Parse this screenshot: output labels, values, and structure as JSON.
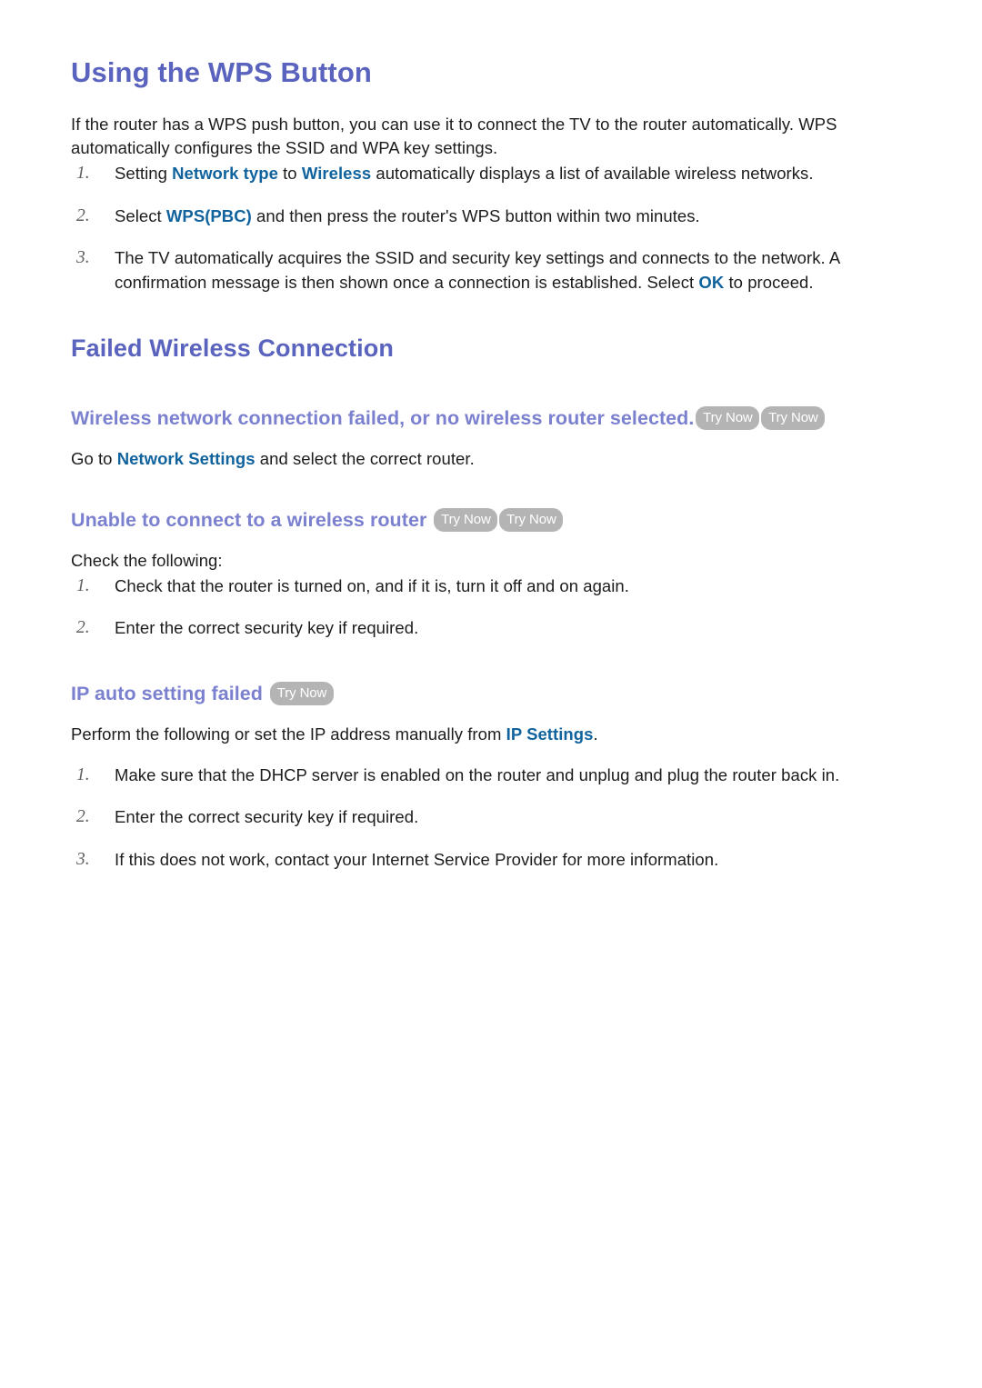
{
  "document": {
    "sections": [
      {
        "id": "using-wps-button",
        "heading": "Using the WPS Button",
        "intro": "If the router has a WPS push button, you can use it to connect the TV to the router automatically. WPS automatically configures the SSID and WPA key settings.",
        "steps": [
          {
            "marker": "1.",
            "pre": "Setting ",
            "kw1": "Network type",
            "mid": " to ",
            "kw2": "Wireless",
            "post": " automatically displays a list of available wireless networks."
          },
          {
            "marker": "2.",
            "pre": "Select ",
            "kw1": "WPS(PBC)",
            "post": " and then press the router's WPS button within two minutes."
          },
          {
            "marker": "3.",
            "pre": "The TV automatically acquires the SSID and security key settings and connects to the network. A confirmation message is then shown once a connection is established. Select ",
            "kw1": "OK",
            "post": " to proceed."
          }
        ]
      }
    ],
    "failed_wireless": {
      "heading": "Failed Wireless Connection",
      "subsections": [
        {
          "id": "wireless-connection-failed",
          "heading": "Wireless network connection failed, or no wireless router selected.",
          "badges": [
            "Try Now",
            "Try Now"
          ],
          "body_pre": "Go to ",
          "body_kw": "Network Settings",
          "body_post": " and select the correct router."
        },
        {
          "id": "unable-to-connect",
          "heading": "Unable to connect to a wireless router",
          "badges": [
            "Try Now",
            "Try Now"
          ],
          "lead": "Check the following:",
          "steps": [
            {
              "marker": "1.",
              "text": "Check that the router is turned on, and if it is, turn it off and on again."
            },
            {
              "marker": "2.",
              "text": "Enter the correct security key if required."
            }
          ]
        },
        {
          "id": "ip-auto-setting-failed",
          "heading": "IP auto setting failed",
          "badges": [
            "Try Now"
          ],
          "lead_pre": "Perform the following or set the IP address manually from ",
          "lead_kw": "IP Settings",
          "lead_post": ".",
          "steps": [
            {
              "marker": "1.",
              "text": "Make sure that the DHCP server is enabled on the router and unplug and plug the router back in."
            },
            {
              "marker": "2.",
              "text": "Enter the correct security key if required."
            },
            {
              "marker": "3.",
              "text": "If this does not work, contact your Internet Service Provider for more information."
            }
          ]
        }
      ]
    },
    "colors": {
      "heading_primary": "#5a63bd",
      "heading_secondary": "#7b80cf",
      "keyword_blue": "#11639e",
      "badge_bg": "#b4b4b4",
      "badge_text": "#ffffff",
      "body_text": "#1c1c1c",
      "marker_gray": "#606060"
    }
  }
}
